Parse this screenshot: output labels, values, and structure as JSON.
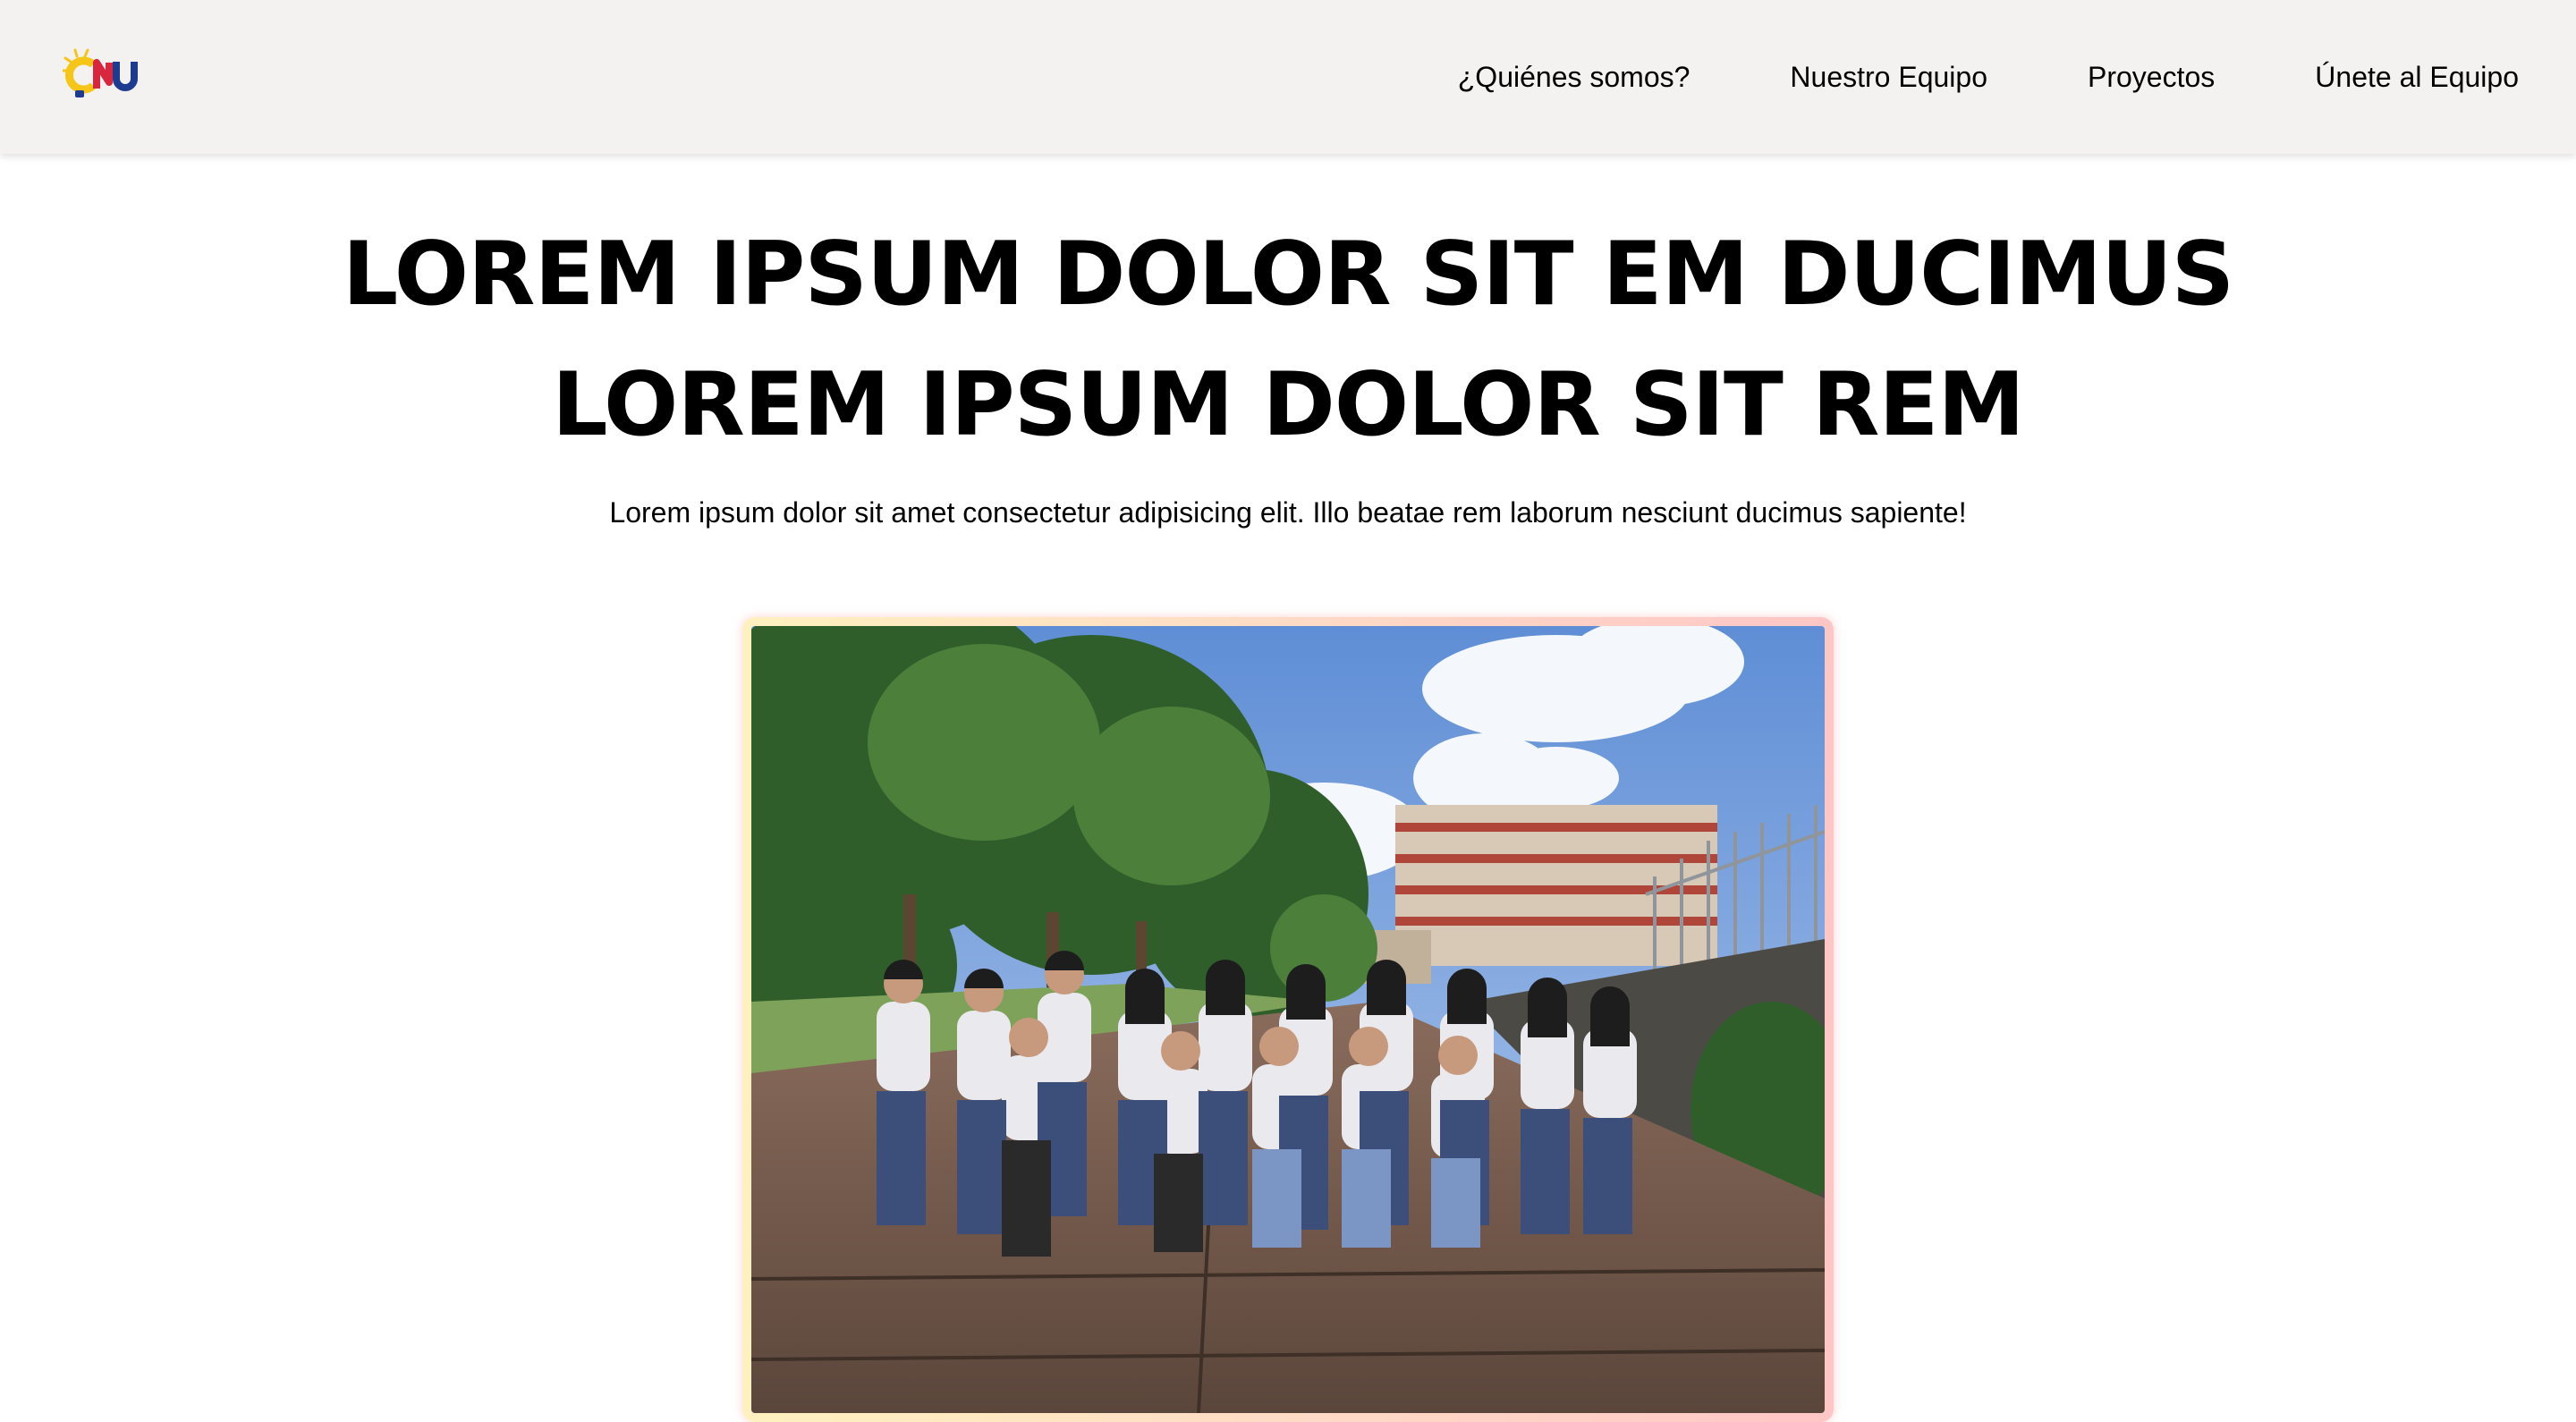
{
  "brand": {
    "logo_text": "CNU",
    "colors": {
      "yellow": "#f5c518",
      "red": "#d7263d",
      "blue": "#1f3b8f"
    }
  },
  "nav": {
    "items": [
      {
        "label": "¿Quiénes somos?"
      },
      {
        "label": "Nuestro Equipo"
      },
      {
        "label": "Proyectos"
      },
      {
        "label": "Únete al Equipo"
      }
    ]
  },
  "hero": {
    "title_line1": "LOREM IPSUM DOLOR SIT EM DUCIMUS",
    "title_line2": "LOREM IPSUM DOLOR SIT REM",
    "subtitle": "Lorem ipsum dolor sit amet consectetur adipisicing elit. Illo beatae rem laborum nesciunt ducimus sapiente!"
  },
  "colors": {
    "nav_bg": "#f3f2f0",
    "frame_gradient_start": "#fff1bf",
    "frame_gradient_end": "#ffc6c6"
  }
}
